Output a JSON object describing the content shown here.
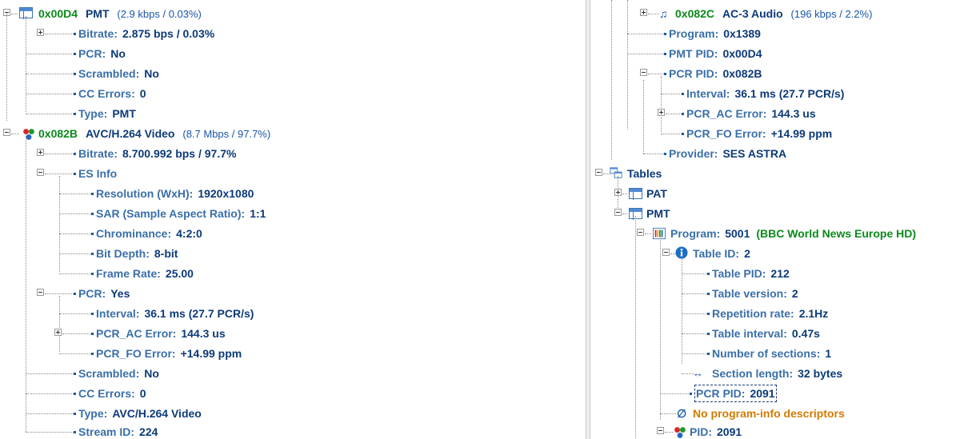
{
  "left_tree": {
    "pmt_stream": {
      "pid": "0x00D4",
      "name": "PMT",
      "rate": "(2.9 kbps / 0.03%)"
    },
    "pmt_props": [
      {
        "label": "Bitrate:",
        "value": "2.875 bps / 0.03%"
      },
      {
        "label": "PCR:",
        "value": "No"
      },
      {
        "label": "Scrambled:",
        "value": "No"
      },
      {
        "label": "CC Errors:",
        "value": "0"
      },
      {
        "label": "Type:",
        "value": "PMT"
      }
    ],
    "video_stream": {
      "pid": "0x082B",
      "name": "AVC/H.264 Video",
      "rate": "(8.7 Mbps / 97.7%)"
    },
    "video_bitrate": {
      "label": "Bitrate:",
      "value": "8.700.992 bps / 97.7%"
    },
    "es_info": {
      "label": "ES Info"
    },
    "es_props": [
      {
        "label": "Resolution (WxH):",
        "value": "1920x1080"
      },
      {
        "label": "SAR (Sample Aspect Ratio):",
        "value": "1:1"
      },
      {
        "label": "Chrominance:",
        "value": "4:2:0"
      },
      {
        "label": "Bit Depth:",
        "value": "8-bit"
      },
      {
        "label": "Frame Rate:",
        "value": "25.00"
      }
    ],
    "pcr": {
      "label": "PCR:",
      "value": "Yes"
    },
    "pcr_props": [
      {
        "label": "Interval:",
        "value": "36.1 ms (27.7 PCR/s)"
      },
      {
        "label": "PCR_AC Error:",
        "value": "144.3 us"
      },
      {
        "label": "PCR_FO Error:",
        "value": "+14.99 ppm"
      }
    ],
    "video_tail": [
      {
        "label": "Scrambled:",
        "value": "No"
      },
      {
        "label": "CC Errors:",
        "value": "0"
      },
      {
        "label": "Type:",
        "value": "AVC/H.264 Video"
      },
      {
        "label": "Stream ID:",
        "value": "224"
      }
    ]
  },
  "right_tree": {
    "audio_stream": {
      "pid": "0x082C",
      "name": "AC-3 Audio",
      "rate": "(196 kbps / 2.2%)"
    },
    "program": {
      "label": "Program:",
      "value": "0x1389"
    },
    "pmt_pid": {
      "label": "PMT PID:",
      "value": "0x00D4"
    },
    "pcr_pid": {
      "label": "PCR PID:",
      "value": "0x082B"
    },
    "pcr_props": [
      {
        "label": "Interval:",
        "value": "36.1 ms (27.7 PCR/s)"
      },
      {
        "label": "PCR_AC Error:",
        "value": "144.3 us"
      },
      {
        "label": "PCR_FO Error:",
        "value": "+14.99 ppm"
      }
    ],
    "provider": {
      "label": "Provider:",
      "value": "SES ASTRA"
    },
    "tables": {
      "label": "Tables"
    },
    "pat": {
      "label": "PAT"
    },
    "pmt": {
      "label": "PMT"
    },
    "pmt_program": {
      "label": "Program:",
      "value": "5001",
      "service": "(BBC World News Europe HD)"
    },
    "table_id": {
      "label": "Table ID:",
      "value": "2"
    },
    "table_props": [
      {
        "label": "Table PID:",
        "value": "212"
      },
      {
        "label": "Table version:",
        "value": "2"
      },
      {
        "label": "Repetition rate:",
        "value": "2.1Hz"
      },
      {
        "label": "Table interval:",
        "value": "0.47s"
      },
      {
        "label": "Number of sections:",
        "value": "1"
      }
    ],
    "section_length": {
      "label": "Section length:",
      "value": "32 bytes"
    },
    "pcr_pid2": {
      "label": "PCR PID:",
      "value": "2091"
    },
    "no_desc": {
      "label": "No program-info descriptors"
    },
    "pid": {
      "label": "PID:",
      "value": "2091"
    }
  },
  "icons": [
    "table-icon",
    "video-streams-icon",
    "music-note-icon",
    "tables-icon",
    "program-bars-icon",
    "info-icon",
    "range-arrows-icon",
    "empty-set-icon"
  ]
}
